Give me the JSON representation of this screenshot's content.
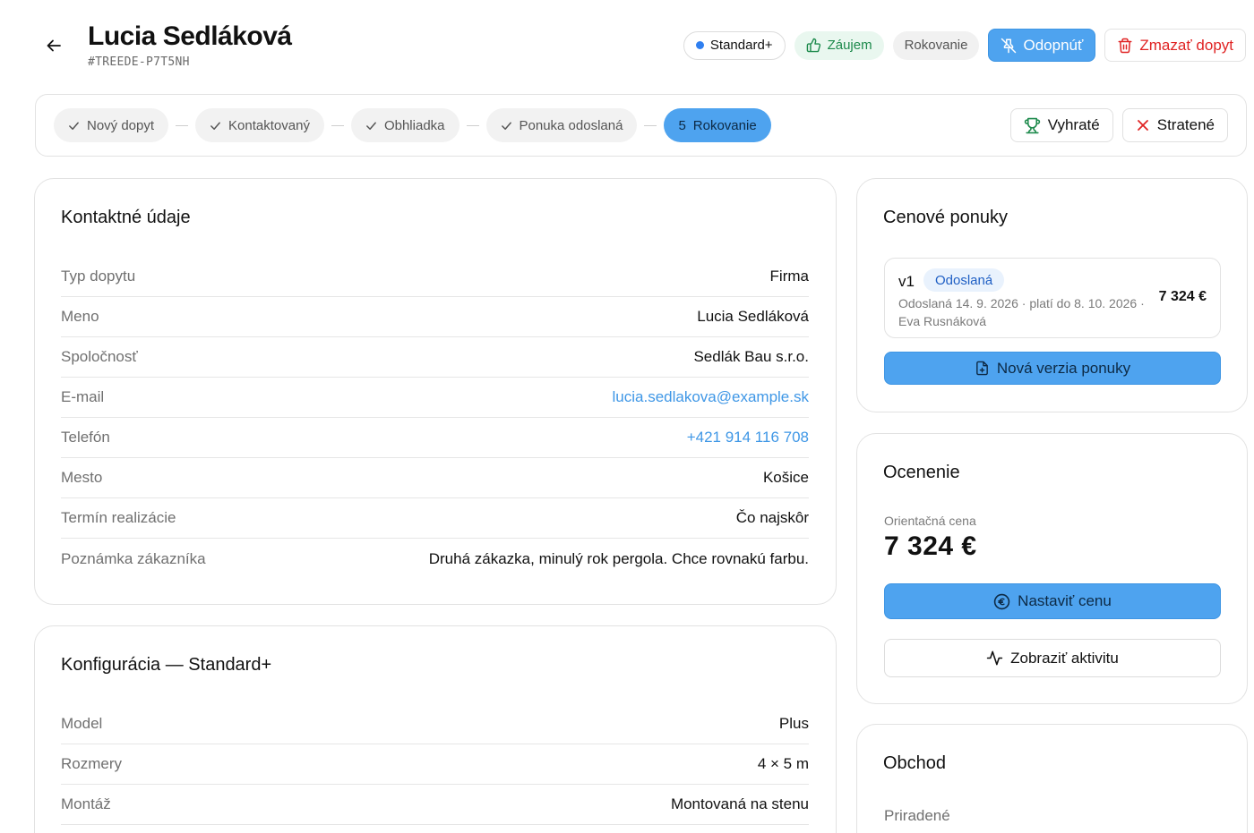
{
  "header": {
    "title": "Lucia Sedláková",
    "code": "#TREEDE-P7T5NH",
    "tags": {
      "standard": "Standard+",
      "zaujem": "Záujem",
      "rokovanie": "Rokovanie"
    },
    "actions": {
      "unpin": "Odopnúť",
      "delete": "Zmazať dopyt"
    }
  },
  "stages": {
    "items": [
      {
        "label": "Nový dopyt",
        "state": "done"
      },
      {
        "label": "Kontaktovaný",
        "state": "done"
      },
      {
        "label": "Obhliadka",
        "state": "done"
      },
      {
        "label": "Ponuka odoslaná",
        "state": "done"
      },
      {
        "label": "Rokovanie",
        "number": "5",
        "state": "active"
      }
    ],
    "won": "Vyhraté",
    "lost": "Stratené"
  },
  "contact": {
    "title": "Kontaktné údaje",
    "rows": [
      {
        "label": "Typ dopytu",
        "value": "Firma"
      },
      {
        "label": "Meno",
        "value": "Lucia Sedláková"
      },
      {
        "label": "Spoločnosť",
        "value": "Sedlák Bau s.r.o."
      },
      {
        "label": "E-mail",
        "value": "lucia.sedlakova@example.sk"
      },
      {
        "label": "Telefón",
        "value": "+421 914 116 708"
      },
      {
        "label": "Mesto",
        "value": "Košice"
      },
      {
        "label": "Termín realizácie",
        "value": "Čo najskôr"
      },
      {
        "label": "Poznámka zákazníka",
        "value": "Druhá zákazka, minulý rok pergola. Chce rovnakú farbu."
      }
    ]
  },
  "config": {
    "title": "Konfigurácia — Standard+",
    "rows": [
      {
        "label": "Model",
        "value": "Plus"
      },
      {
        "label": "Rozmery",
        "value": "4 × 5 m"
      },
      {
        "label": "Montáž",
        "value": "Montovaná na stenu"
      }
    ]
  },
  "offers": {
    "title": "Cenové ponuky",
    "items": [
      {
        "version": "v1",
        "status": "Odoslaná",
        "meta": "Odoslaná 14. 9. 2026 · platí do 8. 10. 2026 · Eva Rusnáková",
        "amount": "7 324 €"
      }
    ],
    "new_version": "Nová verzia ponuky"
  },
  "pricing": {
    "title": "Ocenenie",
    "label": "Orientačná cena",
    "value": "7 324 €",
    "set_price": "Nastaviť cenu",
    "show_activity": "Zobraziť aktivitu"
  },
  "deal": {
    "title": "Obchod",
    "assigned_label": "Priradené"
  },
  "colors": {
    "accent": "#4ea3ef",
    "danger": "#e02424",
    "success": "#1d8a4c",
    "link": "#3f97e6"
  }
}
